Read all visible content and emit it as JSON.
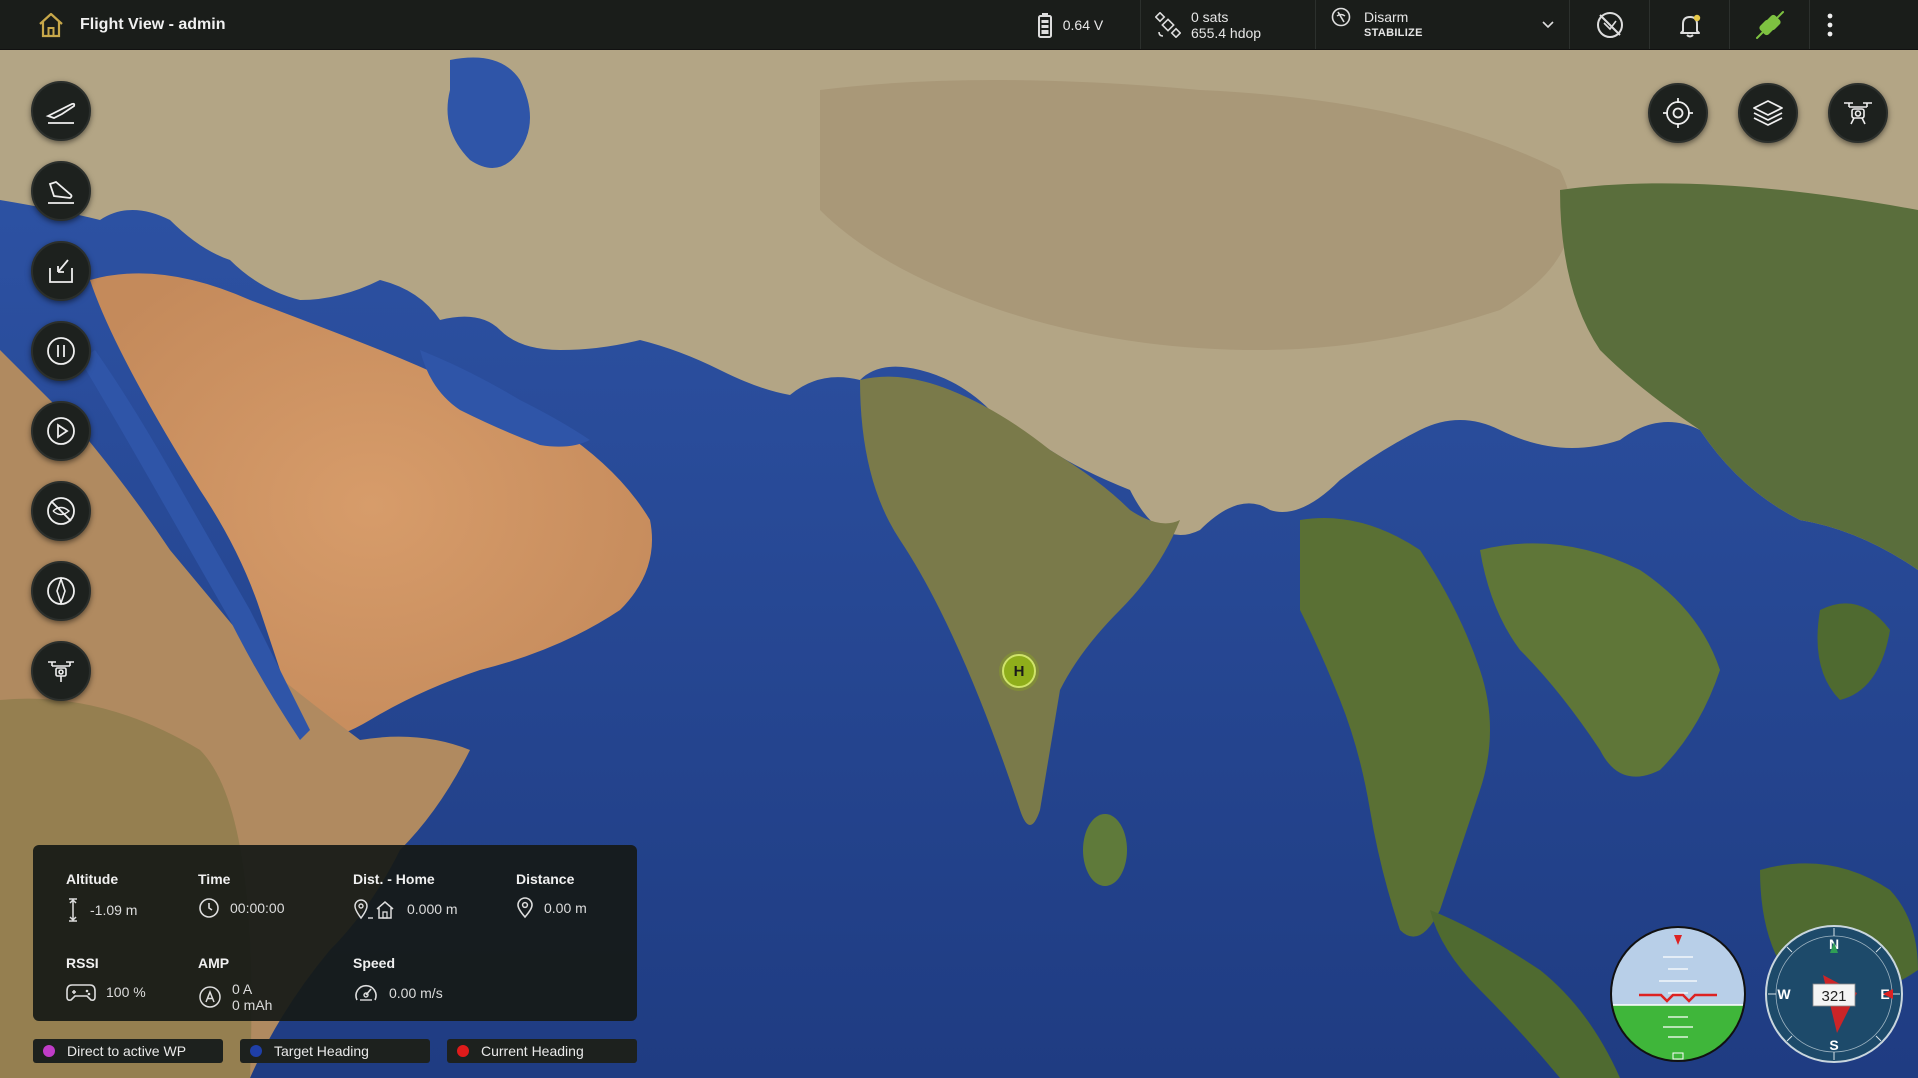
{
  "app": {
    "title": "Flight View - admin"
  },
  "status": {
    "battery": "0.64 V",
    "gps_sats": "0 sats",
    "gps_hdop": "655.4 hdop",
    "arm_state": "Disarm",
    "flight_mode": "STABILIZE"
  },
  "map": {
    "home_marker_label": "H"
  },
  "telemetry": {
    "altitude_label": "Altitude",
    "altitude_value": "-1.09 m",
    "time_label": "Time",
    "time_value": "00:00:00",
    "dist_home_label": "Dist. - Home",
    "dist_home_value": "0.000 m",
    "distance_label": "Distance",
    "distance_value": "0.00 m",
    "rssi_label": "RSSI",
    "rssi_value": "100 %",
    "amp_label": "AMP",
    "amp_value_a": "0 A",
    "amp_value_mah": "0 mAh",
    "speed_label": "Speed",
    "speed_value": "0.00 m/s"
  },
  "legend": {
    "items": [
      {
        "label": "Direct to active WP",
        "color": "#c03cc8"
      },
      {
        "label": "Target Heading",
        "color": "#1f3fa8"
      },
      {
        "label": "Current Heading",
        "color": "#e01b1b"
      }
    ]
  },
  "compass": {
    "heading": "321",
    "n": "N",
    "e": "E",
    "s": "S",
    "w": "W"
  },
  "colors": {
    "accent_green": "#7ec241",
    "panel_bg": "#1a1d1a"
  }
}
